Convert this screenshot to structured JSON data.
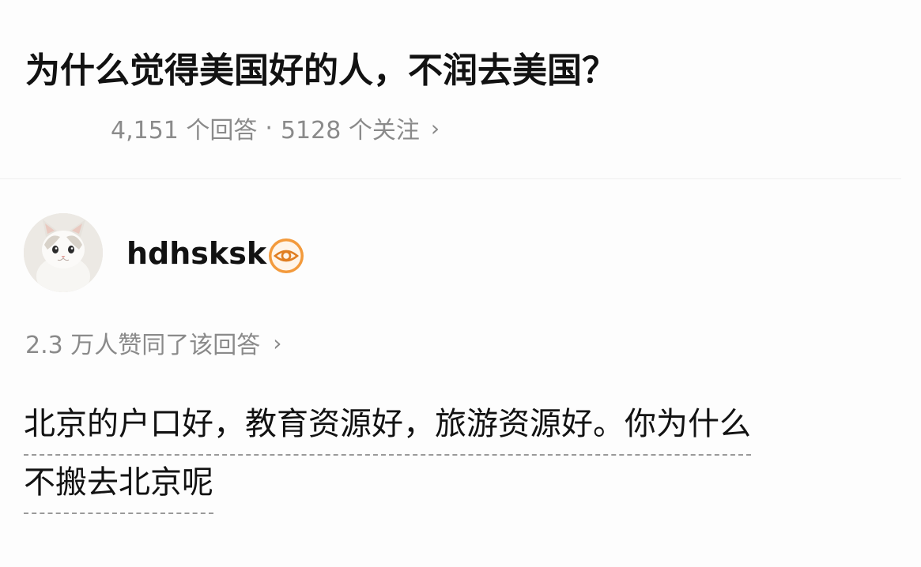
{
  "question": {
    "title": "为什么觉得美国好的人，不润去美国？",
    "answers_count": "4,151 个回答",
    "separator": "·",
    "followers_count": "5128 个关注",
    "more_chevron": "›"
  },
  "author": {
    "name": "hdhsksk",
    "avatar_icon": "cat-avatar-icon",
    "badge_icon": "eye-badge-icon",
    "badge_color": "#f39a3c"
  },
  "upvote": {
    "text": "2.3 万人赞同了该回答",
    "chevron": "›"
  },
  "answer": {
    "lines": [
      "北京的户口好，教育资源好，旅游资源好。你为什么",
      "不搬去北京呢"
    ]
  }
}
